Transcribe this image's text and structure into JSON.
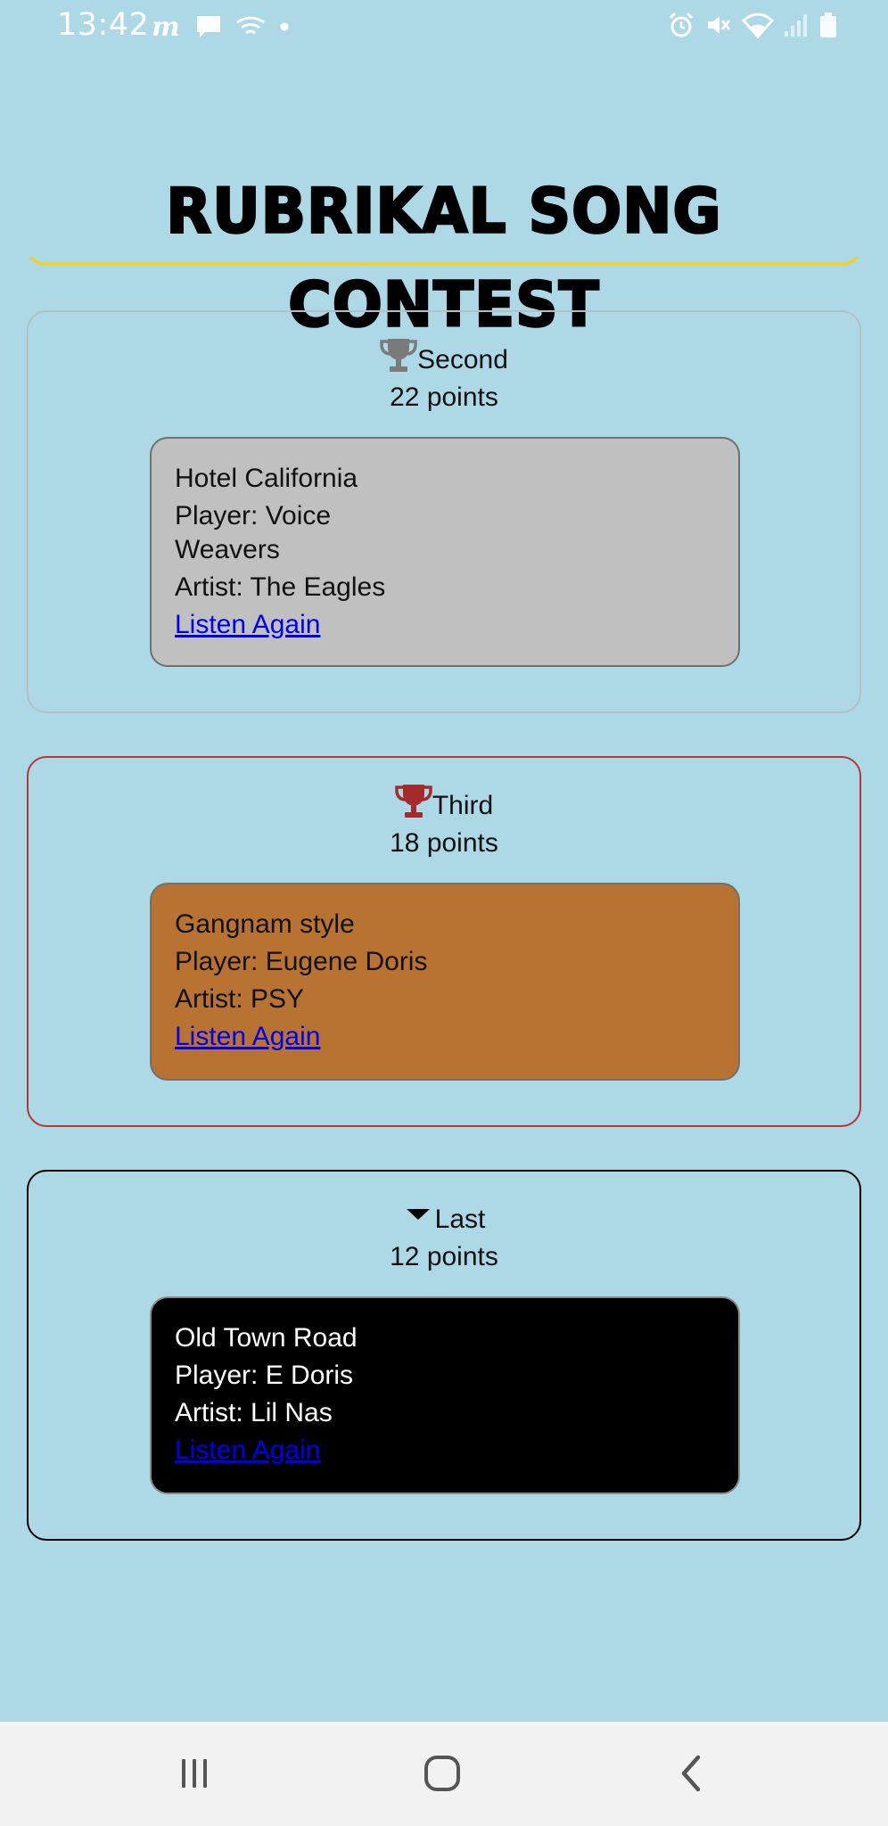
{
  "status_bar": {
    "time": "13:42"
  },
  "page": {
    "title": "RUBRIKAL SONG CONTEST",
    "accent_color": "#e8d23a",
    "background_color": "#add8e6"
  },
  "ranks": [
    {
      "label": "Second",
      "points": "22 points",
      "icon": "trophy-icon",
      "border_color": "#b5c0c6",
      "box_color": "#c0c0c0",
      "song": {
        "title": "Hotel California",
        "player": "Player: Voice Weavers",
        "artist": "Artist: The Eagles",
        "link": "Listen Again"
      }
    },
    {
      "label": "Third",
      "points": "18 points",
      "icon": "trophy-icon",
      "border_color": "#b03a3a",
      "box_color": "#b87333",
      "song": {
        "title": "Gangnam style",
        "player": "Player: Eugene Doris",
        "artist": "Artist: PSY",
        "link": "Listen Again"
      }
    },
    {
      "label": "Last",
      "points": "12 points",
      "icon": "caret-down-icon",
      "border_color": "#000000",
      "box_color": "#000000",
      "song": {
        "title": "Old Town Road",
        "player": "Player: E Doris",
        "artist": "Artist: Lil Nas",
        "link": "Listen Again"
      }
    }
  ],
  "nav_bar": {
    "recent_icon": "recent-apps-icon",
    "home_icon": "home-icon",
    "back_icon": "back-icon"
  }
}
